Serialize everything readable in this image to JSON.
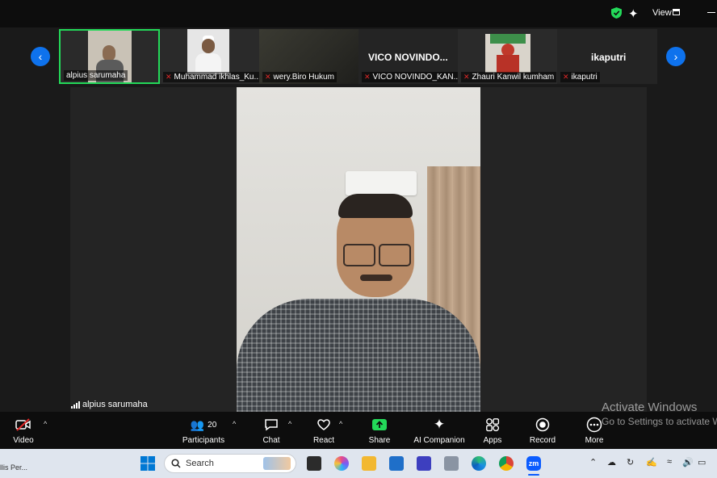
{
  "topbar": {
    "view_label": "View"
  },
  "participants_strip": [
    {
      "name": "alpius sarumaha",
      "muted": false,
      "active": true
    },
    {
      "name": "Muhammad  ikhlas_Ku...",
      "muted": true
    },
    {
      "name": "wery.Biro Hukum",
      "muted": true
    },
    {
      "name": "VICO NOVINDO_KAN...",
      "muted": true,
      "display_text": "VICO  NOVINDO..."
    },
    {
      "name": "Zhauri Kanwil kumham",
      "muted": true
    },
    {
      "name": "ikaputri",
      "muted": true,
      "display_text": "ikaputri"
    }
  ],
  "main_video": {
    "speaker_name": "alpius sarumaha"
  },
  "watermark": {
    "line1": "Activate Windows",
    "line2": "Go to Settings to activate W"
  },
  "toolbar": {
    "video": "Video",
    "participants": "Participants",
    "participants_count": "20",
    "chat": "Chat",
    "react": "React",
    "share": "Share",
    "ai_companion": "AI Companion",
    "apps": "Apps",
    "record": "Record",
    "more": "More"
  },
  "taskbar": {
    "left_text": "llis Per...",
    "search_placeholder": "Search",
    "zoom_icon_text": "zm"
  },
  "colors": {
    "active_border": "#23d959",
    "nav_blue": "#0e72ed",
    "share_green": "#23d959",
    "muted_red": "#e02828"
  }
}
